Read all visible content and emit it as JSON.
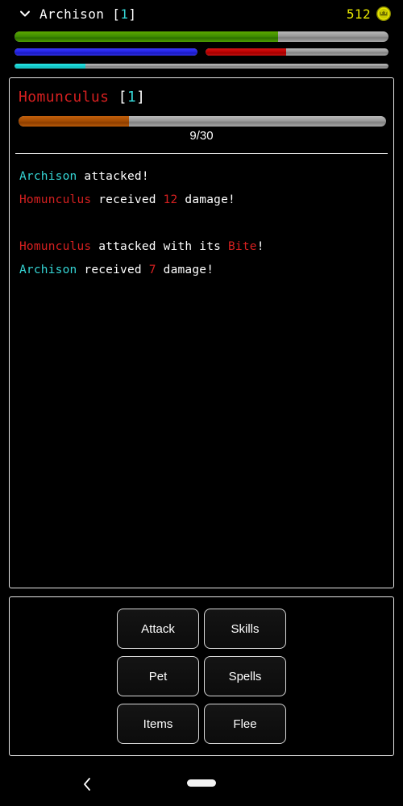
{
  "header": {
    "collapse_icon": "chevron-down-icon",
    "player_name": "Archison",
    "player_level_open": " [",
    "player_level": "1",
    "player_level_close": "]",
    "gold_amount": "512",
    "gold_icon": "coin-icon"
  },
  "stat_bars": {
    "hp": {
      "name": "health-bar",
      "percent": 70.5,
      "color": "#3f8c00"
    },
    "mp": {
      "name": "mana-bar",
      "percent": 100,
      "color": "#2222e0"
    },
    "stamina": {
      "name": "stamina-bar",
      "percent": 44,
      "color": "#bb0000"
    },
    "xp": {
      "name": "experience-bar",
      "percent": 19,
      "color": "#15d0d0"
    },
    "track_color": "#9a9a9a"
  },
  "enemy": {
    "name": "Homunculus",
    "level_open": " [",
    "level": "1",
    "level_close": "]",
    "hp_current": 9,
    "hp_max": 30,
    "hp_text": "9/30",
    "hp_percent": 30,
    "hp_color": "#a34a00",
    "name_color": "#d62020"
  },
  "battle_log": [
    {
      "id": "log-line-1",
      "parts": [
        {
          "text": "Archison",
          "style": "player"
        },
        {
          "text": " attacked!",
          "style": "plain"
        }
      ]
    },
    {
      "id": "log-line-2",
      "parts": [
        {
          "text": "Homunculus",
          "style": "enemy"
        },
        {
          "text": " received ",
          "style": "plain"
        },
        {
          "text": "12",
          "style": "dmg"
        },
        {
          "text": " damage!",
          "style": "plain"
        }
      ]
    },
    {
      "id": "log-line-3",
      "blank": true,
      "parts": []
    },
    {
      "id": "log-line-4",
      "parts": [
        {
          "text": "Homunculus",
          "style": "enemy"
        },
        {
          "text": " attacked with its ",
          "style": "plain"
        },
        {
          "text": "Bite",
          "style": "skill"
        },
        {
          "text": "!",
          "style": "plain"
        }
      ]
    },
    {
      "id": "log-line-5",
      "parts": [
        {
          "text": "Archison",
          "style": "player"
        },
        {
          "text": " received ",
          "style": "plain"
        },
        {
          "text": "7",
          "style": "dmg"
        },
        {
          "text": " damage!",
          "style": "plain"
        }
      ]
    }
  ],
  "actions": {
    "rows": [
      [
        {
          "id": "attack",
          "label": "Attack"
        },
        {
          "id": "skills",
          "label": "Skills"
        }
      ],
      [
        {
          "id": "pet",
          "label": "Pet"
        },
        {
          "id": "spells",
          "label": "Spells"
        }
      ],
      [
        {
          "id": "items",
          "label": "Items"
        },
        {
          "id": "flee",
          "label": "Flee"
        }
      ]
    ]
  },
  "nav_bar": {
    "back_icon": "chevron-left-icon",
    "home_indicator": "home-pill-indicator"
  }
}
